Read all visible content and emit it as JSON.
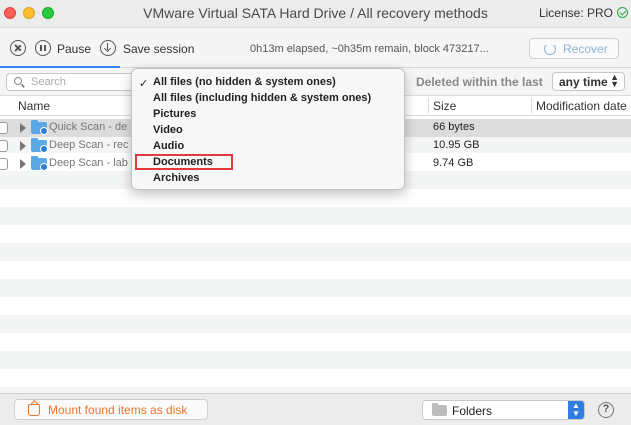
{
  "window": {
    "title": "VMware Virtual SATA Hard Drive / All recovery methods",
    "license_label": "License: PRO"
  },
  "toolbar": {
    "pause_label": "Pause",
    "save_label": "Save session",
    "status_text": "0h13m elapsed, ~0h35m remain, block 473217...",
    "recover_label": "Recover"
  },
  "filters": {
    "search_placeholder": "Search",
    "deleted_label": "Deleted within the last",
    "time_value": "any time",
    "type_menu": {
      "selected_index": 0,
      "options": [
        "All files (no hidden & system ones)",
        "All files (including hidden & system ones)",
        "Pictures",
        "Video",
        "Audio",
        "Documents",
        "Archives"
      ],
      "highlighted": "Documents"
    }
  },
  "table": {
    "columns": [
      "Name",
      "Size",
      "Modification date"
    ],
    "rows": [
      {
        "name": "Quick Scan - de",
        "size": "66 bytes"
      },
      {
        "name": "Deep Scan - rec",
        "size": "10.95 GB"
      },
      {
        "name": "Deep Scan - lab",
        "size": "9.74 GB"
      }
    ]
  },
  "bottom": {
    "mount_label": "Mount found items as disk",
    "view_value": "Folders",
    "help_label": "?"
  },
  "colors": {
    "accent": "#2f7de1",
    "mount_orange": "#e8762c",
    "highlight_red": "#e23b3b"
  }
}
